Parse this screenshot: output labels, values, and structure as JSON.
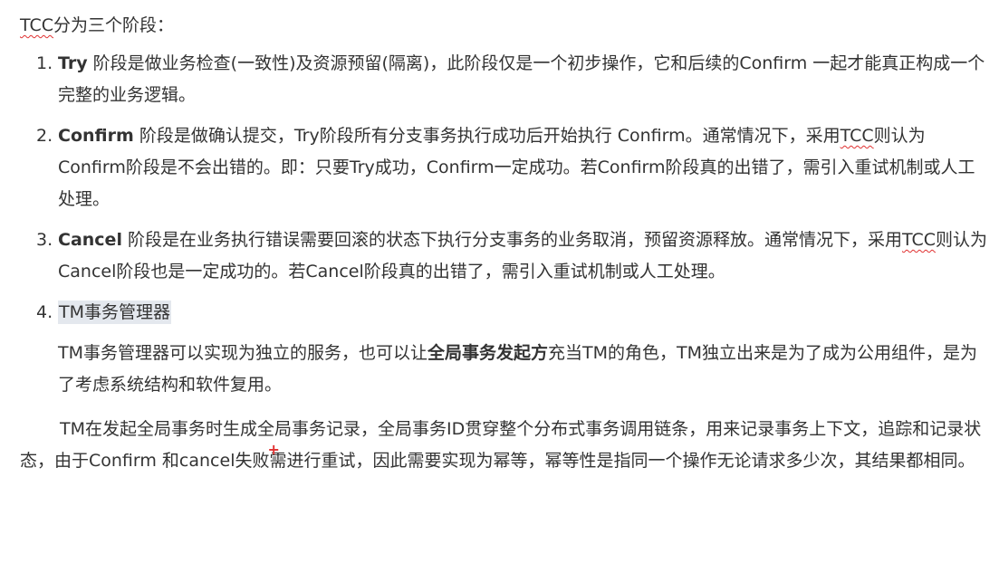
{
  "intro": {
    "tcc": "TCC",
    "rest": "分为三个阶段："
  },
  "items": [
    {
      "num": "1.",
      "term": "Try",
      "text": " 阶段是做业务检查(一致性)及资源预留(隔离)，此阶段仅是一个初步操作，它和后续的Confirm 一起才能真正构成一个完整的业务逻辑。"
    },
    {
      "num": "2.",
      "term": "Confirm",
      "text_a": " 阶段是做确认提交，Try阶段所有分支事务执行成功后开始执行 Confirm。通常情况下，采用",
      "tcc": "TCC",
      "text_b": "则认为 Confirm阶段是不会出错的。即：只要Try成功，Confirm一定成功。若Confirm阶段真的出错了，需引入重试机制或人工处理。"
    },
    {
      "num": "3.",
      "term": "Cancel",
      "text_a": " 阶段是在业务执行错误需要回滚的状态下执行分支事务的业务取消，预留资源释放。通常情况下，采用",
      "tcc": "TCC",
      "text_b": "则认为Cancel阶段也是一定成功的。若Cancel阶段真的出错了，需引入重试机制或人工处理。"
    },
    {
      "num": "4.",
      "heading": "TM事务管理器",
      "sub_a": "TM事务管理器可以实现为独立的服务，也可以让",
      "sub_bold": "全局事务发起方",
      "sub_b": "充当TM的角色，TM独立出来是为了成为公用组件，是为了考虑系统结构和软件复用。"
    }
  ],
  "final": {
    "part_a": "TM在发起全局事务时生成全局事务记录，全局事务ID贯穿整个分布式事务调用链条，用来记录事务上下文，追踪和记录状态，由于Confirm 和cancel",
    "cursor": "+",
    "part_b": "失败需进行重试，因此需要实现为幂等，幂等性是指同一个操作无论请求多少次，其结果都相同。"
  },
  "colors": {
    "text": "#333333",
    "spell_underline": "#e03030",
    "highlight": "#e4e8ee"
  }
}
